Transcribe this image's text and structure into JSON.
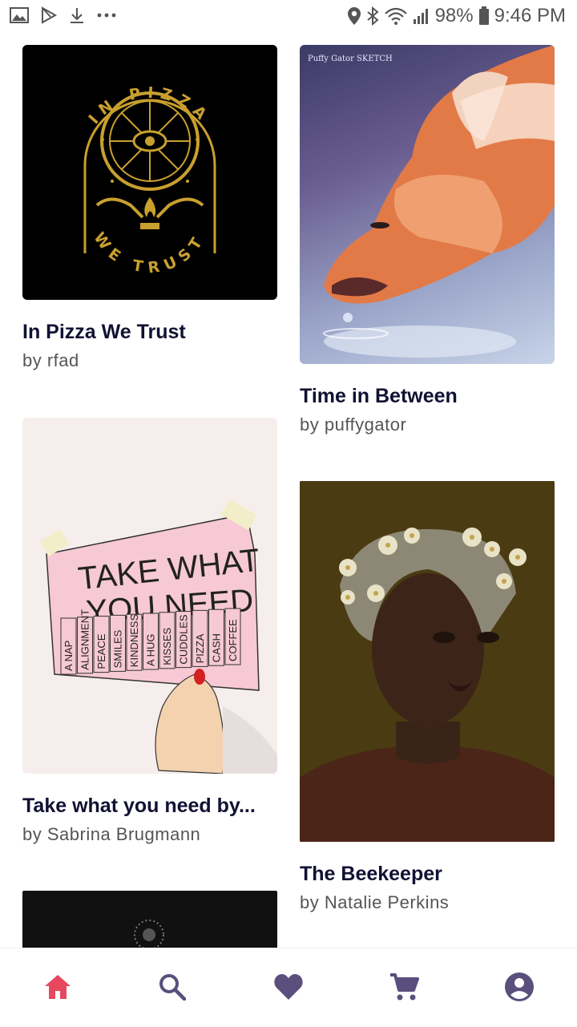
{
  "status_bar": {
    "battery": "98%",
    "time": "9:46 PM",
    "icons": [
      "image-icon",
      "play-store-icon",
      "download-icon",
      "more-icon",
      "location-icon",
      "bluetooth-icon",
      "wifi-icon",
      "signal-icon",
      "battery-icon"
    ]
  },
  "cards": [
    {
      "title": "In Pizza We Trust",
      "artist": "by rfad",
      "art_text_top": "IN PIZZA",
      "art_text_bottom": "WE TRUST"
    },
    {
      "title": "Time in Between",
      "artist": "by puffygator",
      "art_signature": "Puffy Gator SKETCH"
    },
    {
      "title": "Take what you need by...",
      "artist": "by Sabrina Brugmann",
      "art_heading_1": "TAKE WHAT",
      "art_heading_2": "YOU NEED",
      "art_tabs": [
        "A NAP",
        "ALIGNMENT",
        "PEACE",
        "SMILES",
        "KINDNESS",
        "A HUG",
        "KISSES",
        "CUDDLES",
        "PIZZA",
        "CASH",
        "COFFEE"
      ]
    },
    {
      "title": "The Beekeeper",
      "artist": "by Natalie Perkins"
    }
  ],
  "bottom_nav": {
    "items": [
      {
        "name": "home",
        "icon": "home-icon",
        "active": true
      },
      {
        "name": "search",
        "icon": "search-icon",
        "active": false
      },
      {
        "name": "favorites",
        "icon": "heart-icon",
        "active": false
      },
      {
        "name": "cart",
        "icon": "cart-icon",
        "active": false
      },
      {
        "name": "account",
        "icon": "account-icon",
        "active": false
      }
    ],
    "active_color": "#e8485e",
    "inactive_color": "#5a4f7d"
  }
}
